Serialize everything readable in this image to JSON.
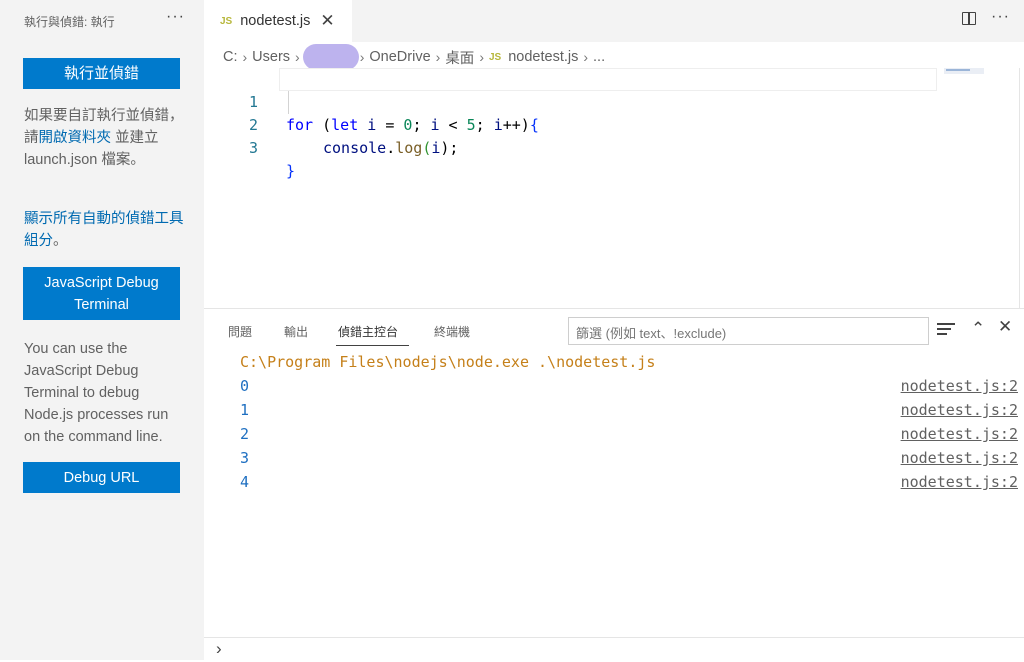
{
  "sidebar": {
    "title": "執行與偵錯: 執行",
    "more": "···",
    "run_button": "執行並偵錯",
    "custom_text_1": "如果要自訂執行並偵錯，請",
    "open_folder_link": "開啟資料夾",
    "custom_text_2": " 並建立 launch.json 檔案。",
    "show_all_link": "顯示所有自動的偵錯工具組分",
    "show_all_suffix": "。",
    "js_debug_terminal_button": "JavaScript Debug Terminal",
    "js_debug_description": "You can use the JavaScript Debug Terminal to debug Node.js processes run on the command line.",
    "debug_url_button": "Debug URL"
  },
  "tabbar": {
    "tab": {
      "icon": "JS",
      "label": "nodetest.js",
      "close": "✕"
    },
    "split_icon": "split-editor-icon",
    "more": "···"
  },
  "breadcrumb": {
    "items": [
      "C:",
      "Users",
      "OneDrive",
      "桌面",
      "nodetest.js",
      "..."
    ],
    "file_icon": "JS"
  },
  "editor": {
    "lines": [
      {
        "number": "1"
      },
      {
        "number": "2"
      },
      {
        "number": "3"
      }
    ],
    "code": {
      "l1_for": "for",
      "l1_paren_open": " (",
      "l1_let": "let",
      "l1_i1": " i",
      "l1_eq": " = ",
      "l1_zero": "0",
      "l1_semi1": "; ",
      "l1_i2": "i",
      "l1_lt": " < ",
      "l1_five": "5",
      "l1_semi2": "; ",
      "l1_i3": "i",
      "l1_inc": "++)",
      "l1_brace": "{",
      "l2_console": "console",
      "l2_dot": ".",
      "l2_log": "log",
      "l2_paren": "(",
      "l2_i": "i",
      "l2_close": ");",
      "l3_brace": "}"
    }
  },
  "panel": {
    "tabs": [
      "問題",
      "輸出",
      "偵錯主控台",
      "終端機"
    ],
    "active_tab": "偵錯主控台",
    "filter_placeholder": "篩選 (例如 text、!exclude)",
    "icons": [
      "filter-list-icon",
      "chevron-up-icon",
      "close-icon"
    ],
    "console": {
      "command": "C:\\Program Files\\nodejs\\node.exe .\\nodetest.js",
      "outputs": [
        {
          "value": "0",
          "source": "nodetest.js:2"
        },
        {
          "value": "1",
          "source": "nodetest.js:2"
        },
        {
          "value": "2",
          "source": "nodetest.js:2"
        },
        {
          "value": "3",
          "source": "nodetest.js:2"
        },
        {
          "value": "4",
          "source": "nodetest.js:2"
        }
      ]
    },
    "prompt": "›"
  }
}
